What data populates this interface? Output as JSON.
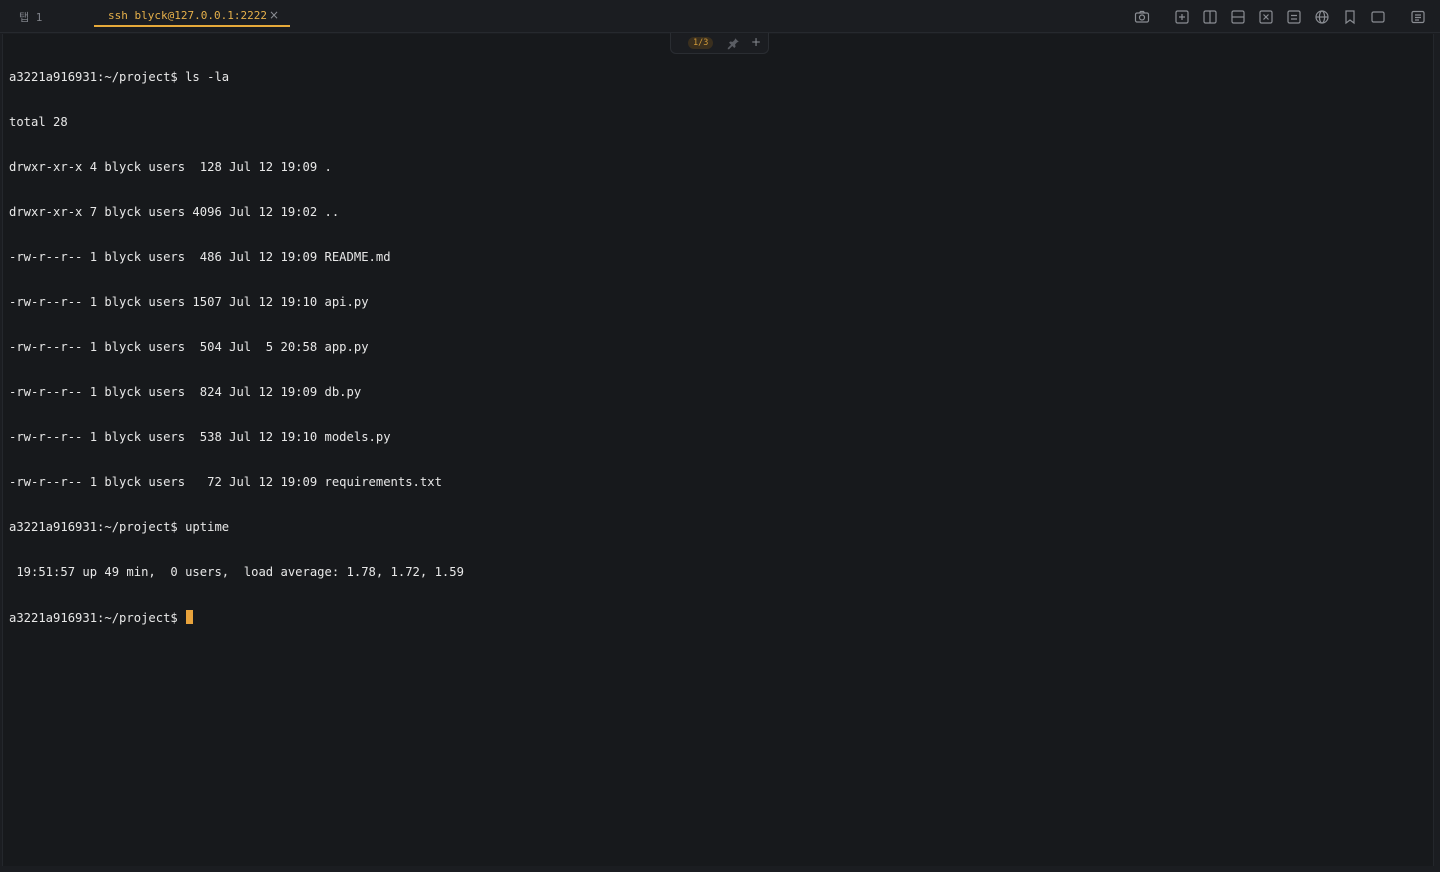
{
  "tabs": [
    {
      "label": "탭 1",
      "active": false
    },
    {
      "label": "ssh blyck@127.0.0.1:2222",
      "active": true,
      "close": "×"
    }
  ],
  "toolbar": {
    "icons": [
      "camera-icon",
      "new-pane-icon",
      "split-vertical-icon",
      "split-horizontal-icon",
      "close-pane-icon",
      "keyboard-icon",
      "globe-icon",
      "bookmark-icon",
      "window-icon",
      "sidebar-icon"
    ]
  },
  "pane_badge": {
    "counter": "1/3",
    "add_label": "+"
  },
  "terminal": {
    "lines": [
      "a3221a916931:~/project$ ls -la",
      "total 28",
      "drwxr-xr-x 4 blyck users  128 Jul 12 19:09 .",
      "drwxr-xr-x 7 blyck users 4096 Jul 12 19:02 ..",
      "-rw-r--r-- 1 blyck users  486 Jul 12 19:09 README.md",
      "-rw-r--r-- 1 blyck users 1507 Jul 12 19:10 api.py",
      "-rw-r--r-- 1 blyck users  504 Jul  5 20:58 app.py",
      "-rw-r--r-- 1 blyck users  824 Jul 12 19:09 db.py",
      "-rw-r--r-- 1 blyck users  538 Jul 12 19:10 models.py",
      "-rw-r--r-- 1 blyck users   72 Jul 12 19:09 requirements.txt",
      "a3221a916931:~/project$ uptime",
      " 19:51:57 up 49 min,  0 users,  load average: 1.78, 1.72, 1.59"
    ],
    "prompt": "a3221a916931:~/project$ "
  },
  "colors": {
    "accent": "#e6a93a",
    "background": "#17191c",
    "text": "#e8e8e8"
  }
}
